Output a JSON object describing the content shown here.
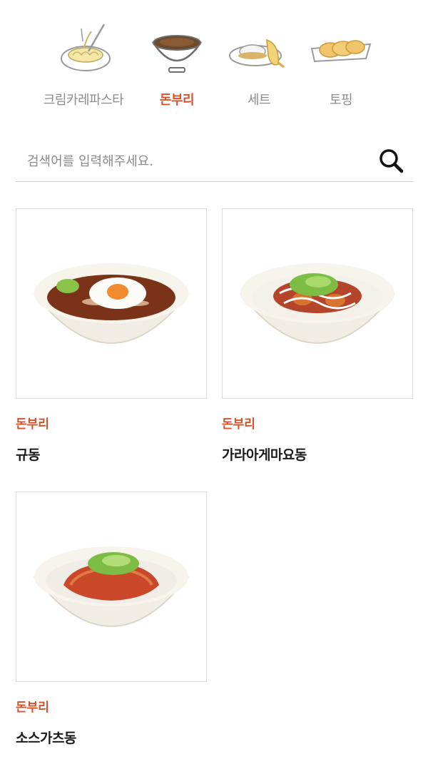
{
  "tabs": [
    {
      "label": "크림카레파스타",
      "icon": "pasta-icon",
      "active": false
    },
    {
      "label": "돈부리",
      "icon": "rice-bowl-icon",
      "active": true
    },
    {
      "label": "세트",
      "icon": "set-meal-icon",
      "active": false
    },
    {
      "label": "토핑",
      "icon": "topping-icon",
      "active": false
    }
  ],
  "search": {
    "placeholder": "검색어를 입력해주세요.",
    "value": "",
    "icon": "search-icon"
  },
  "products": [
    {
      "category": "돈부리",
      "name": "규동",
      "image": "gyudon-bowl"
    },
    {
      "category": "돈부리",
      "name": "가라아게마요동",
      "image": "karaage-mayo-don-bowl"
    },
    {
      "category": "돈부리",
      "name": "소스가츠동",
      "image": "sauce-katsudon-bowl"
    }
  ],
  "colors": {
    "accent": "#d4532a",
    "inactive_tab": "#8c8c8c",
    "border": "#dcdcdc"
  }
}
